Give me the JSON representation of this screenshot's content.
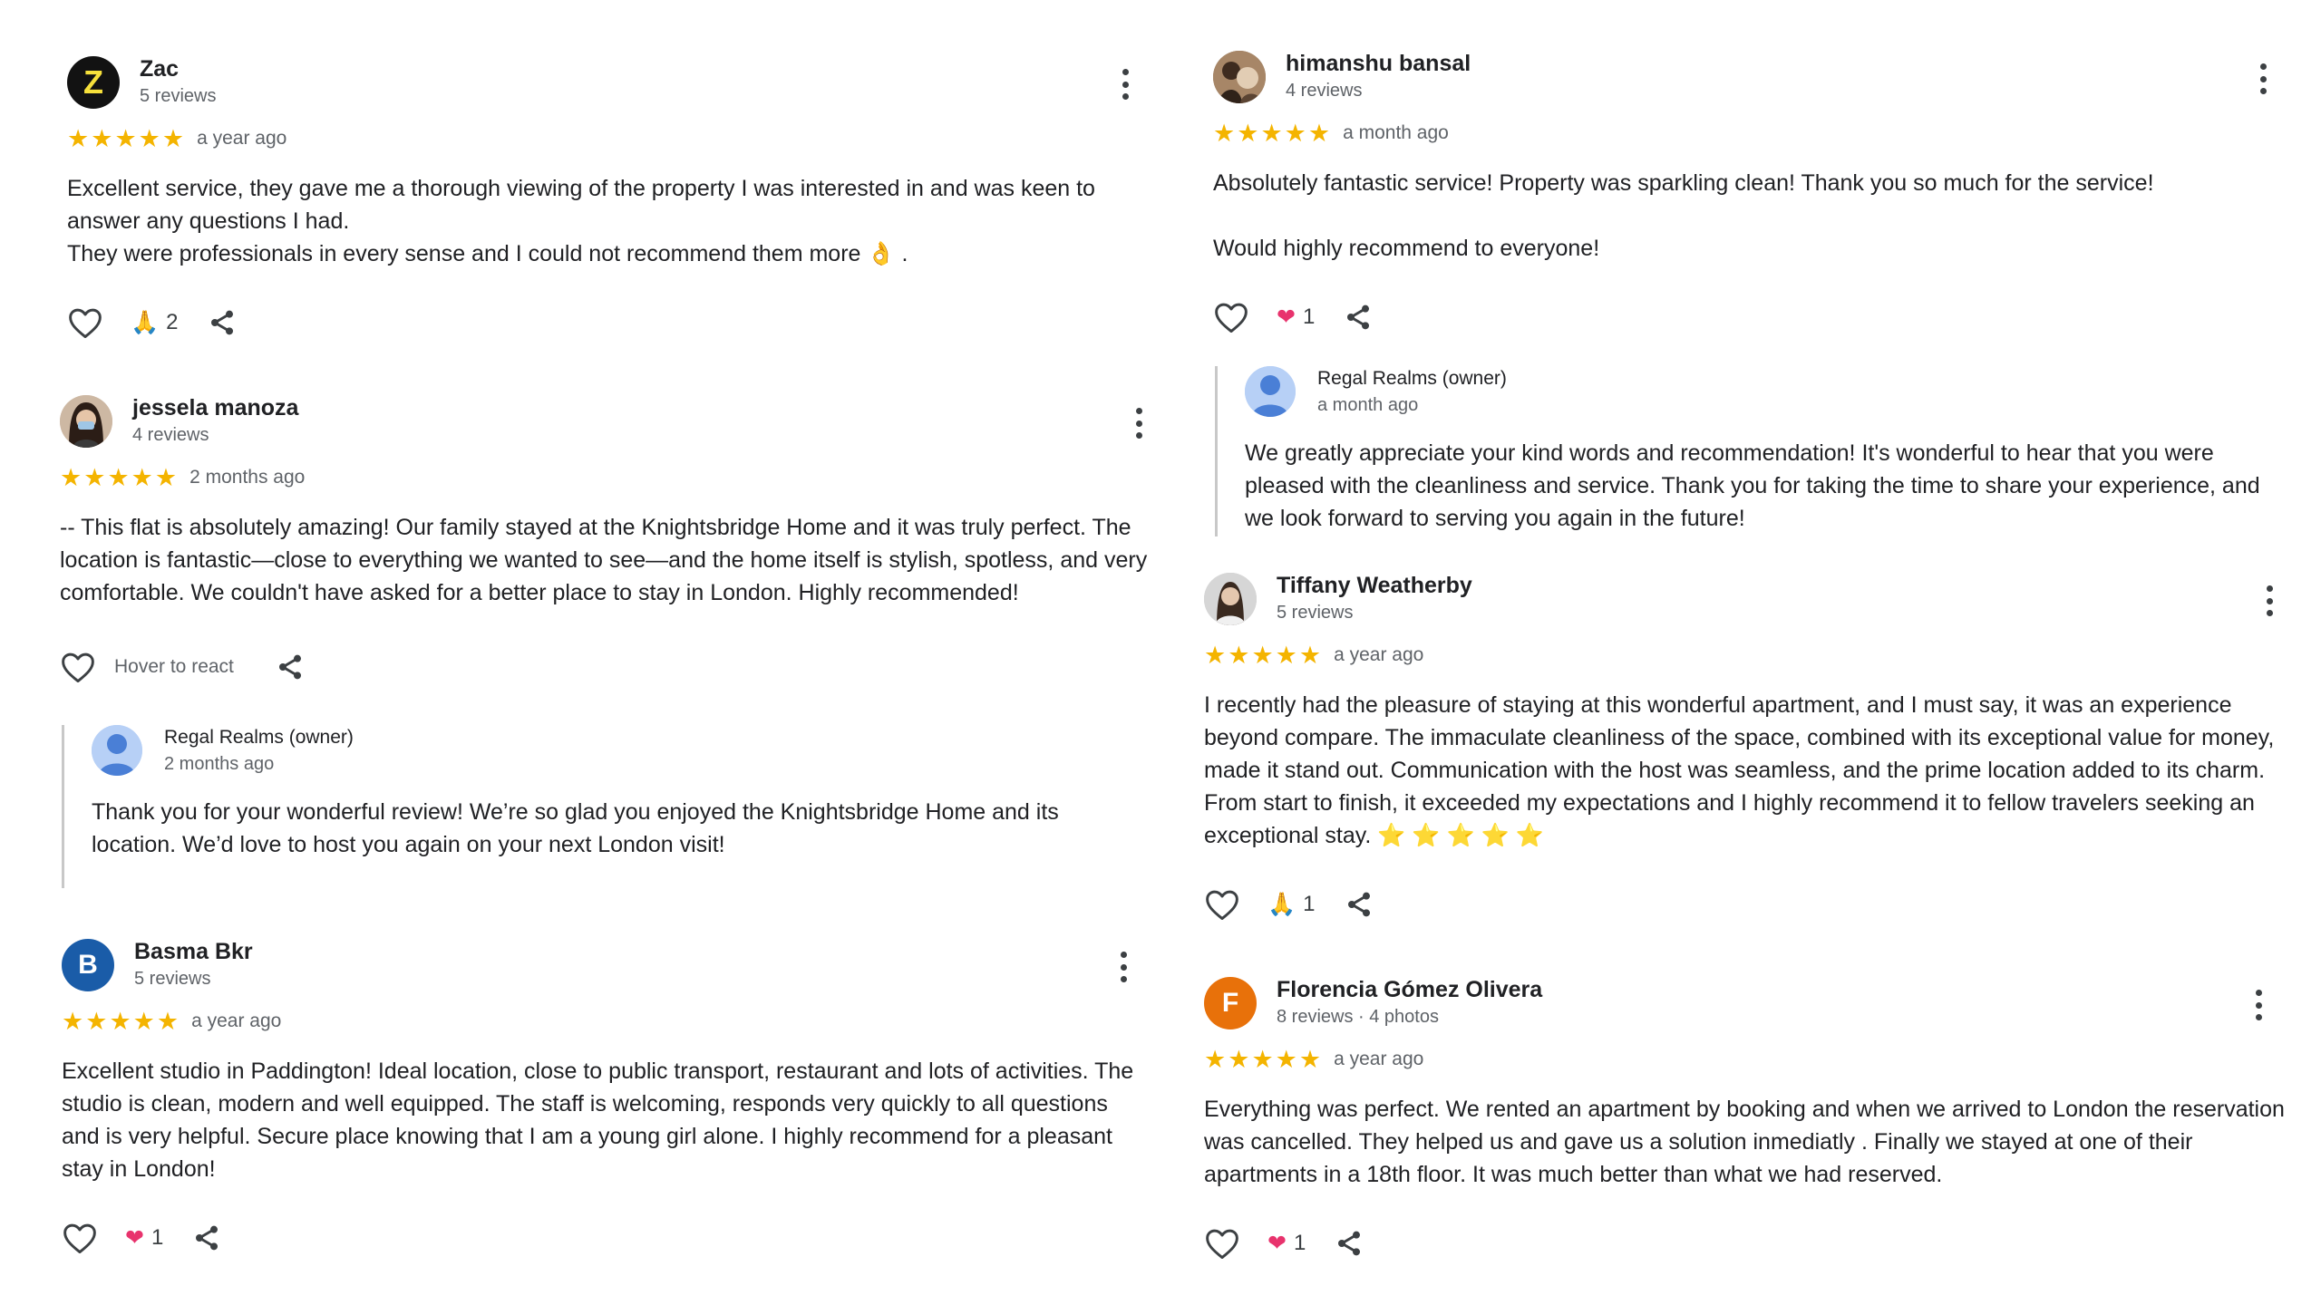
{
  "reviews": {
    "zac": {
      "avatar_letter": "Z",
      "avatar_color": "#121212",
      "name": "Zac",
      "subtitle": "5 reviews",
      "rating": 5,
      "when": "a year ago",
      "text_lines": [
        "Excellent service, they gave me a thorough viewing of the property I was interested in and was keen to answer any questions I had.",
        "They were professionals in every sense and I could not recommend them more 👌 ."
      ],
      "reaction_emoji": "🙏",
      "reaction_count": "2"
    },
    "jessela": {
      "name": "jessela manoza",
      "subtitle": "4 reviews",
      "rating": 5,
      "when": "2 months ago",
      "text": "-- This flat is absolutely amazing! Our family stayed at the Knightsbridge Home and it was truly perfect. The location is fantastic—close to everything we wanted to see—and the home itself is stylish, spotless, and very comfortable. We couldn't have asked for a better place to stay in London. Highly recommended!",
      "hover_label": "Hover to react",
      "owner_reply": {
        "name": "Regal Realms (owner)",
        "when": "2 months ago",
        "text": "Thank you for your wonderful review! We’re so glad you enjoyed the Knightsbridge Home and its location. We’d love to host you again on your next London visit!"
      }
    },
    "basma": {
      "avatar_letter": "B",
      "avatar_color": "#1a5ca8",
      "name": "Basma Bkr",
      "subtitle": "5 reviews",
      "rating": 5,
      "when": "a year ago",
      "text": "Excellent studio in Paddington! Ideal location, close to public transport, restaurant and lots of activities. The studio is clean, modern and well equipped. The staff is welcoming, responds very quickly to all questions and is very helpful. Secure place knowing that I am a young girl alone. I highly recommend for a pleasant stay in London!",
      "reaction_emoji": "❤",
      "reaction_count": "1"
    },
    "himanshu": {
      "name": "himanshu bansal",
      "subtitle": "4 reviews",
      "rating": 5,
      "when": "a month ago",
      "text_lines": [
        "Absolutely fantastic service! Property was sparkling clean! Thank you so much for the service!",
        "Would highly recommend to everyone!"
      ],
      "reaction_emoji": "❤",
      "reaction_count": "1",
      "owner_reply": {
        "name": "Regal Realms (owner)",
        "when": "a month ago",
        "text": "We greatly appreciate your kind words and recommendation! It's wonderful to hear that you were pleased with the cleanliness and service. Thank you for taking the time to share your experience, and we look forward to serving you again in the future!"
      }
    },
    "tiffany": {
      "name": "Tiffany Weatherby",
      "subtitle": "5 reviews",
      "rating": 5,
      "when": "a year ago",
      "text": "I recently had the pleasure of staying at this wonderful apartment, and I must say, it was an experience beyond compare. The immaculate cleanliness of the space, combined with its exceptional value for money, made it stand out. Communication with the host was seamless, and the prime location added to its charm. From start to finish, it exceeded my expectations and I highly recommend it to fellow travelers seeking an exceptional stay.",
      "text_emoji": "⭐ ⭐ ⭐ ⭐ ⭐",
      "reaction_emoji": "🙏",
      "reaction_count": "1"
    },
    "florencia": {
      "avatar_letter": "F",
      "avatar_color": "#e8710a",
      "name": "Florencia Gómez Olivera",
      "subtitle": "8 reviews · 4 photos",
      "rating": 5,
      "when": "a year ago",
      "text": "Everything was perfect. We rented an apartment by booking and when we arrived to London the reservation was cancelled. They helped us and gave us a solution inmediatly . Finally we stayed at one of their apartments in a 18th floor. It was much better than what we had reserved.",
      "reaction_emoji": "❤",
      "reaction_count": "1"
    }
  },
  "colors": {
    "star": "#f4b400",
    "heart_reaction": "#e8336d",
    "owner_avatar": "#4a7fd6"
  }
}
